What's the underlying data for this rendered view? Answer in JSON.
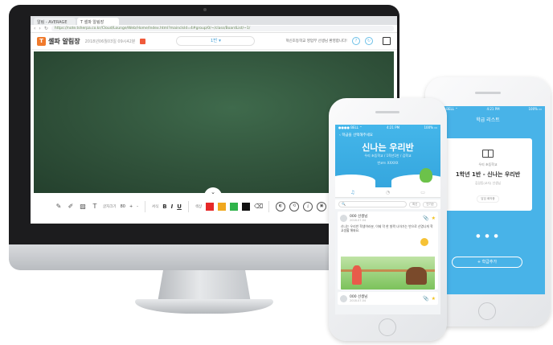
{
  "browser": {
    "tabs": [
      "알림 - AVERAGE",
      "T 셀파 알림장"
    ],
    "url": "https://note.tsherpa.co.kr/Cloud/Lounge/Web/Home/Index.html?mainclsId=4#group/0/~/class/BoardList/~1/"
  },
  "app": {
    "logo_letter": "T",
    "name": "셀파 알림장",
    "datetime": "2018년06월03일 09시42분",
    "class_select": "1반 ▾",
    "greeting": "혁신초등학교 영업부 선생님 환영합니다!",
    "circle_icons": [
      "?",
      "↻"
    ]
  },
  "toolbar": {
    "collapse_arrow": "⌄",
    "font_size_label": "글자크기",
    "font_size_value": "80",
    "font_size_controls": [
      "+",
      "-"
    ],
    "style_label": "서식",
    "bold": "B",
    "italic": "I",
    "underline": "U",
    "color_label": "색상",
    "colors": [
      "#e62828",
      "#f0a81e",
      "#2fb34a",
      "#111111"
    ],
    "round_buttons": [
      "◐",
      "⟲",
      "⤓",
      "▣"
    ]
  },
  "front_phone": {
    "status_left": "●●●● BELL ⌃",
    "status_time": "4:21 PM",
    "status_right": "100% ▭",
    "back_label": "‹ 학급을 선택해주세요",
    "class_title": "신나는 우리반",
    "class_sub": "우리 초등학교 / 1학년1반 / 김학교",
    "class_code": "반코드 XXXXX",
    "tabs": [
      "♫",
      "◔",
      "▭"
    ],
    "search_placeholder": "🔍",
    "filters": [
      "최신",
      "인기순"
    ],
    "post1_author": "000 선생님",
    "post1_time": "2018.07.04",
    "post1_body": "신나는 우리반 학생여러분, 이제 막 한 발짝 나아가는 반으로 신명나게 학교생활 해봐요.",
    "post2_author": "000 선생님",
    "post2_time": "2018.07.04"
  },
  "back_phone": {
    "status_left": "●●●● BELL ⌃",
    "status_time": "4:21 PM",
    "status_right": "100% ▭",
    "title": "학급 리스트",
    "school": "우리 초등학교",
    "class_name": "1학년 1반 - 신나는 우리반",
    "teacher": "김길동(교사) 선생님",
    "badge": "담임 회의중",
    "pager": "● ● ●",
    "add_button": "+ 학급추가"
  }
}
